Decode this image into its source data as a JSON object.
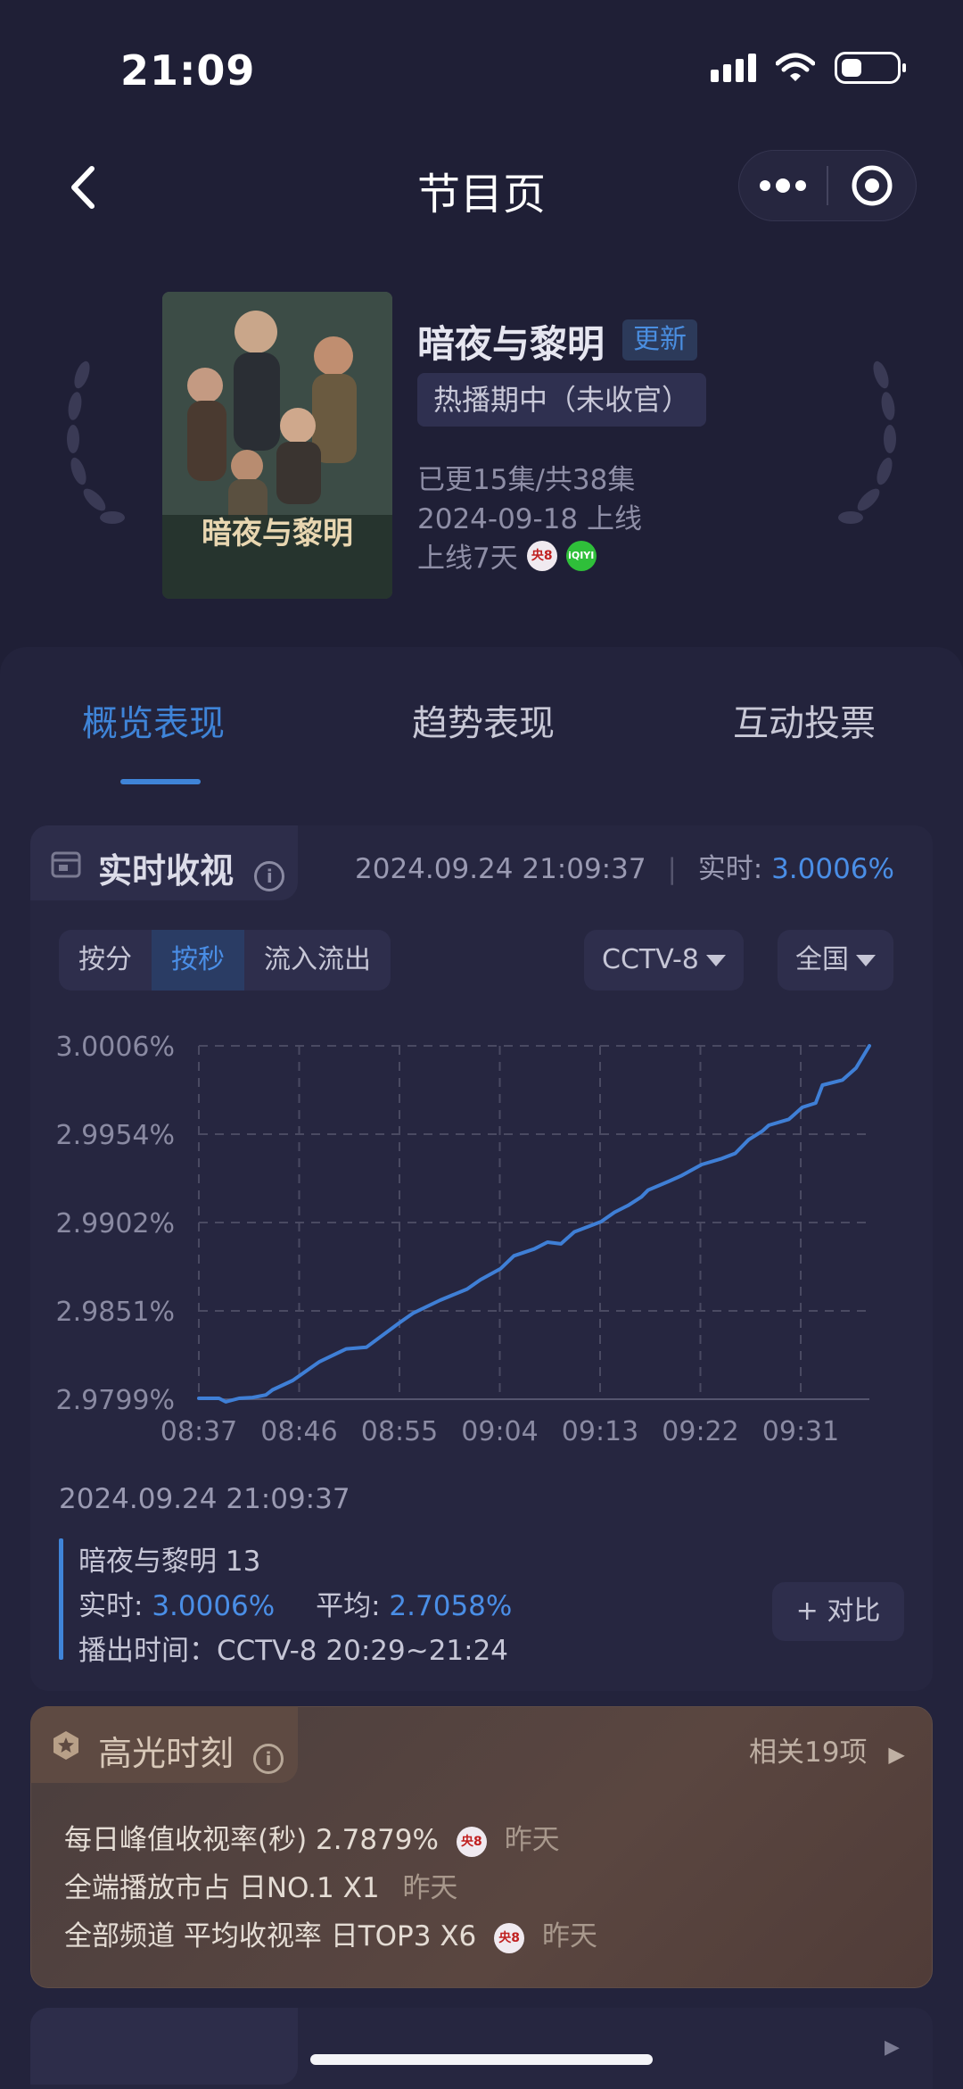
{
  "status_bar": {
    "time": "21:09"
  },
  "nav": {
    "title": "节目页"
  },
  "show": {
    "title": "暗夜与黎明",
    "badge": "更新",
    "status": "热播期中（未收官）",
    "episodes": "已更15集/共38集",
    "premiere": "2024-09-18 上线",
    "days_online": "上线7天",
    "poster_text": "暗夜与黎明",
    "channel_logos": [
      "cctv8-logo",
      "iqiyi-logo"
    ]
  },
  "tabs": [
    {
      "label": "概览表现",
      "active": true
    },
    {
      "label": "趋势表现",
      "active": false
    },
    {
      "label": "互动投票",
      "active": false
    }
  ],
  "realtime": {
    "title": "实时收视",
    "timestamp": "2024.09.24 21:09:37",
    "realtime_label": "实时:",
    "realtime_value": "3.0006%",
    "segments": [
      "按分",
      "按秒",
      "流入流出"
    ],
    "active_segment": "按秒",
    "channel_select": "CCTV-8",
    "region_select": "全国"
  },
  "chart_data": {
    "type": "line",
    "x_ticks": [
      "08:37",
      "08:46",
      "08:55",
      "09:04",
      "09:13",
      "09:22",
      "09:31"
    ],
    "y_ticks": [
      "3.0006%",
      "2.9954%",
      "2.9902%",
      "2.9851%",
      "2.9799%"
    ],
    "ylim": [
      2.9799,
      3.0006
    ],
    "grid": true,
    "series": [
      {
        "color": "#3f7fd6",
        "x": [
          0,
          3,
          4,
          6,
          8,
          10,
          11,
          14,
          18,
          22,
          25,
          30,
          32,
          36,
          40,
          42,
          45,
          47,
          50,
          52,
          54,
          56,
          58,
          60,
          62,
          64,
          66,
          67,
          70,
          72,
          75,
          78,
          80,
          82,
          84,
          85,
          88,
          90,
          92,
          93,
          96,
          98,
          100
        ],
        "y": [
          2.97995,
          2.97995,
          2.97975,
          2.97995,
          2.98,
          2.98015,
          2.98045,
          2.981,
          2.9821,
          2.98285,
          2.98295,
          2.9844,
          2.98495,
          2.9857,
          2.98635,
          2.9869,
          2.98755,
          2.9883,
          2.9887,
          2.9891,
          2.989,
          2.9897,
          2.99,
          2.9903,
          2.99085,
          2.99125,
          2.99175,
          2.99215,
          2.99265,
          2.993,
          2.99365,
          2.994,
          2.9943,
          2.9951,
          2.9956,
          2.99595,
          2.9963,
          2.997,
          2.99725,
          2.9983,
          2.9986,
          2.9993,
          3.0006
        ]
      }
    ]
  },
  "detail": {
    "date": "2024.09.24 21:09:37",
    "episode": "暗夜与黎明 13",
    "realtime_label": "实时:",
    "realtime_value": "3.0006%",
    "avg_label": "平均:",
    "avg_value": "2.7058%",
    "airtime": "播出时间：CCTV-8 20:29~21:24",
    "compare_button": "+ 对比"
  },
  "highlights": {
    "title": "高光时刻",
    "more": "相关19项",
    "items": [
      {
        "text": "每日峰值收视率(秒) 2.7879%",
        "logo": "cctv8-logo",
        "when": "昨天"
      },
      {
        "text": "全端播放市占  日NO.1 X1",
        "logo": "",
        "when": "昨天"
      },
      {
        "text": "全部频道  平均收视率  日TOP3 X6",
        "logo": "cctv8-logo",
        "when": "昨天"
      }
    ]
  },
  "logos": {
    "cctv8": "央8",
    "iqiyi": "iQIYI"
  }
}
